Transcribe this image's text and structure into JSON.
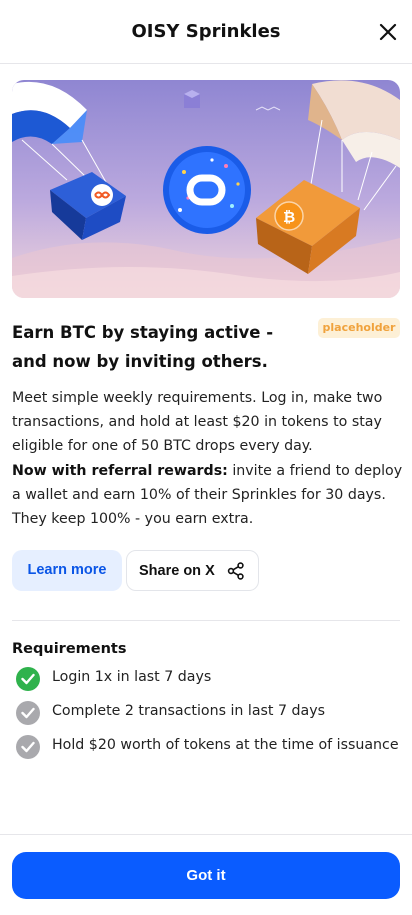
{
  "header": {
    "title": "OISY Sprinkles",
    "close_icon": "close-icon"
  },
  "hero": {
    "alt_icons": [
      "parachute-icon",
      "icp-box-icon",
      "oisy-coin-icon",
      "btc-box-icon"
    ]
  },
  "headline": "Earn BTC by staying active - and now by inviting others.",
  "badge": "placeholder",
  "description": {
    "intro": "Meet simple weekly requirements. Log in, make two transactions, and hold at least $20 in tokens to stay eligible for one of 50 BTC drops every day.",
    "referral_bold": "Now with referral rewards:",
    "referral_text": " invite a friend to deploy a wallet and earn 10% of their Sprinkles for 30 days. They keep 100% - you earn extra."
  },
  "actions": {
    "learn_more": "Learn more",
    "share": "Share on X",
    "share_icon": "share-icon"
  },
  "requirements": {
    "title": "Requirements",
    "items": [
      {
        "label": "Login 1x in last 7 days",
        "done": true
      },
      {
        "label": "Complete 2 transactions in last 7 days",
        "done": false
      },
      {
        "label": "Hold $20 worth of tokens at the time of issuance",
        "done": false
      }
    ]
  },
  "footer": {
    "button": "Got it"
  },
  "colors": {
    "primary": "#0a5cff",
    "success": "#2fb24c",
    "pending": "#a9a9ad",
    "badge_text": "#f0a23c"
  }
}
